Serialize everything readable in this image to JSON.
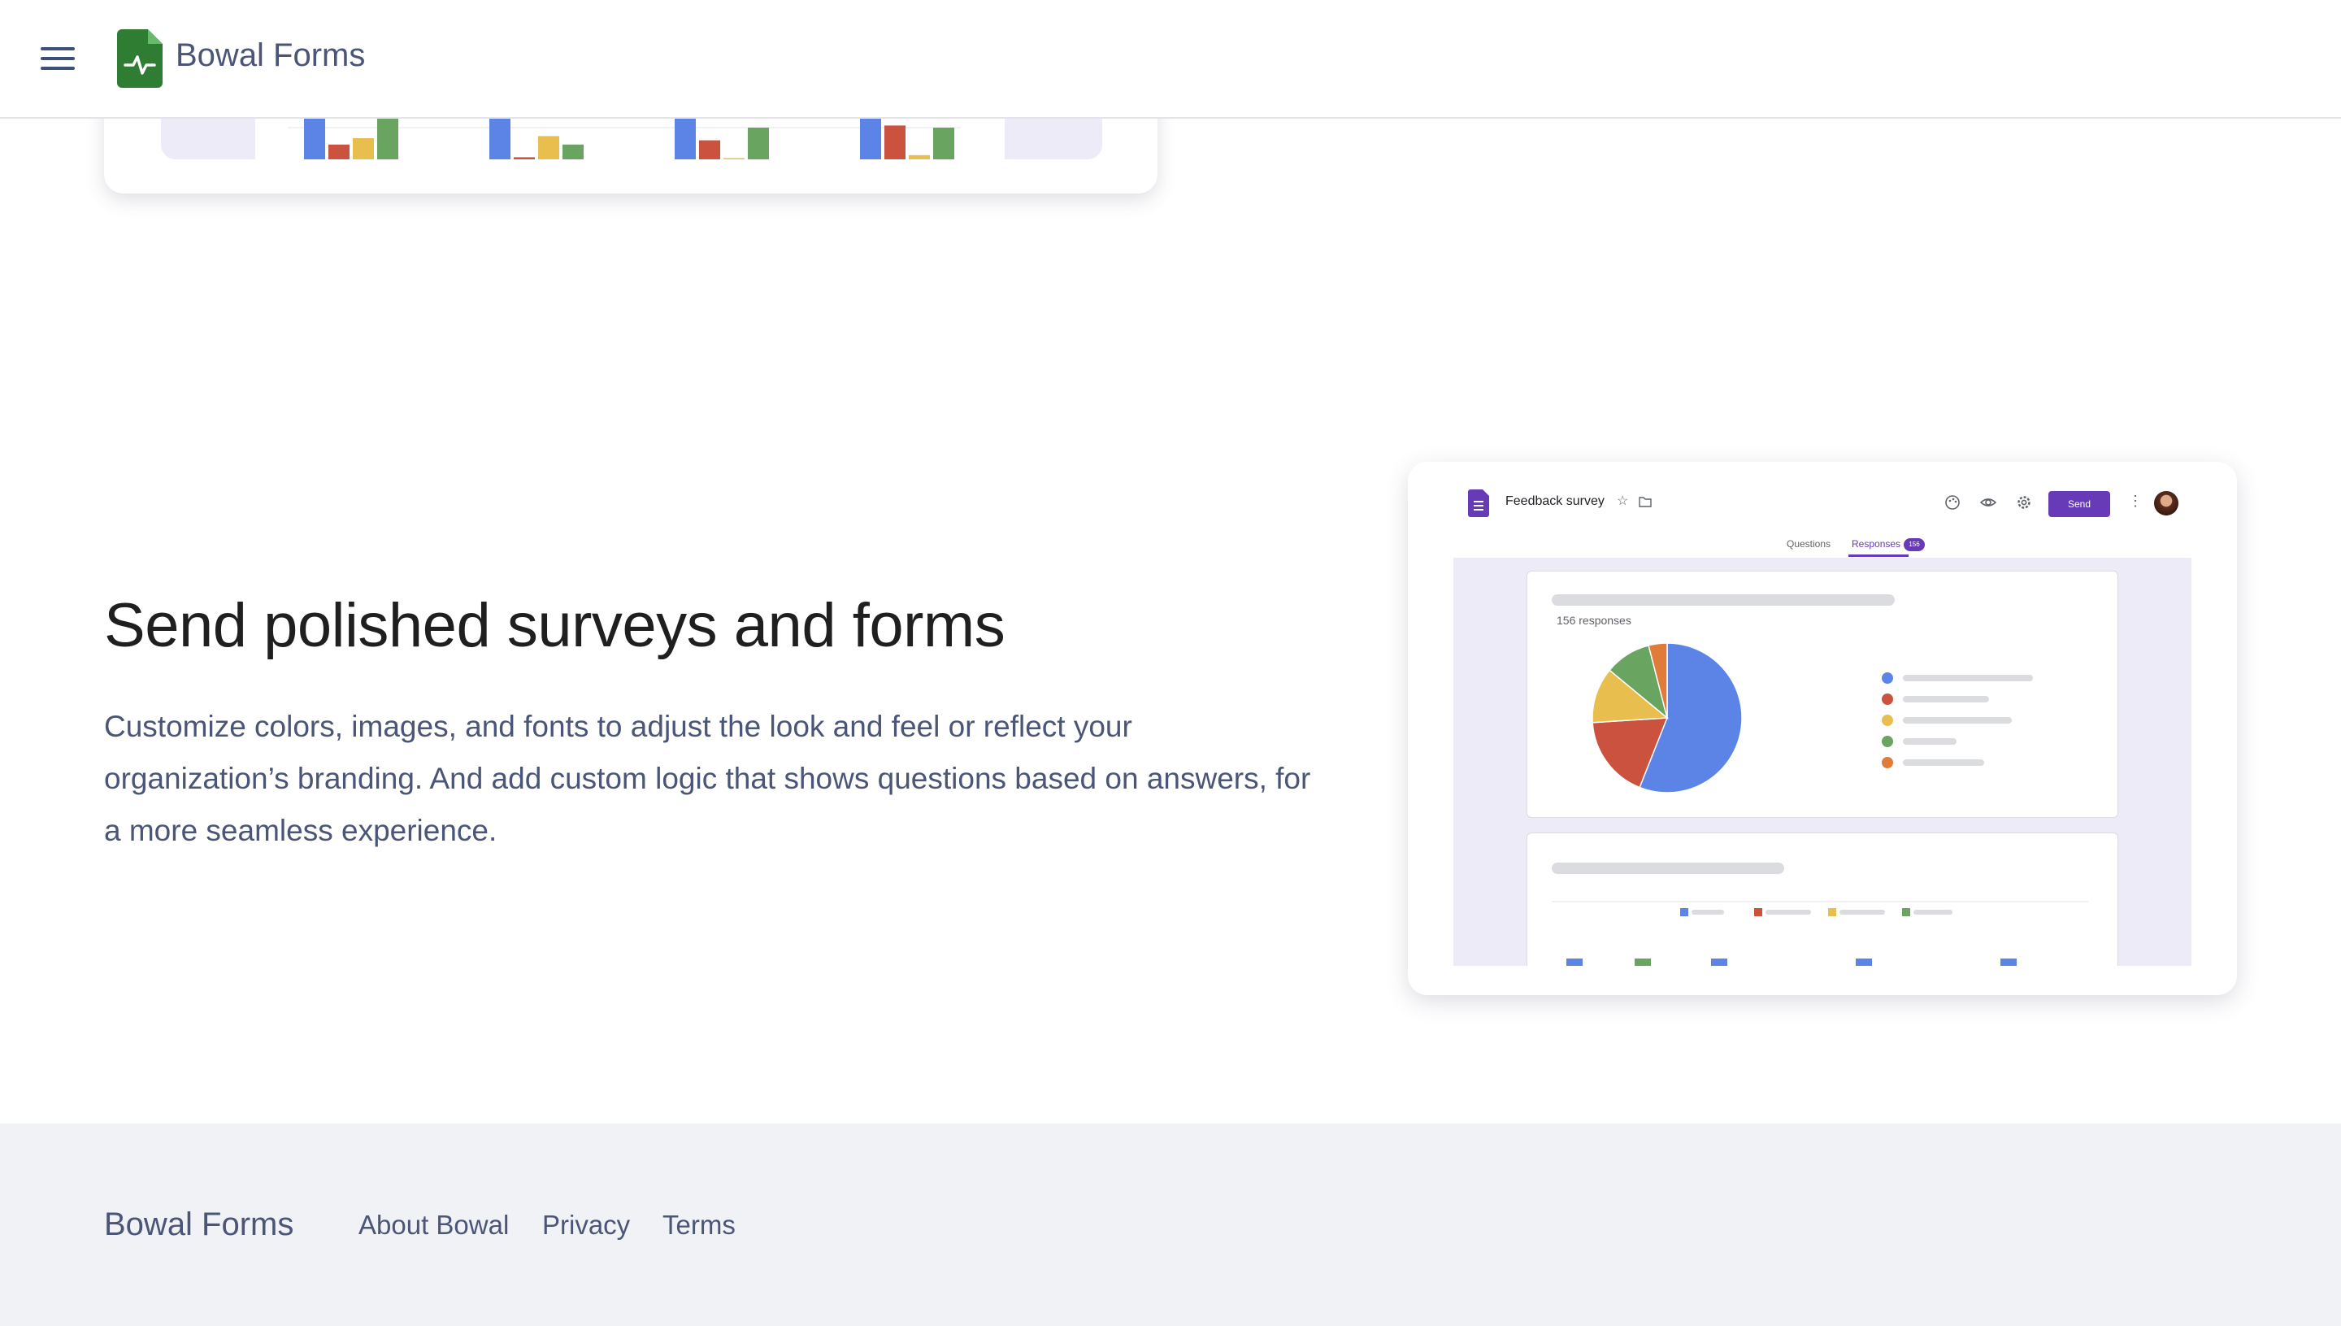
{
  "header": {
    "brand": "Bowal Forms"
  },
  "hero": {
    "title": "Send polished surveys and forms",
    "body": "Customize colors, images, and fonts to adjust the look and feel or reflect your organization’s branding. And add custom logic that shows questions based on answers, for a more seamless experience."
  },
  "mockup": {
    "form_title": "Feedback survey",
    "send_label": "Send",
    "tabs": [
      {
        "label": "Questions",
        "active": false
      },
      {
        "label": "Responses",
        "active": true
      }
    ],
    "responses_badge": "156",
    "responses_count_text": "156 responses",
    "accent_color": "#673ab7",
    "series_colors": [
      "#5b84e6",
      "#cc5240",
      "#e8bf4e",
      "#6aa461",
      "#e07b3a"
    ]
  },
  "chart_data": [
    {
      "type": "pie",
      "values": [
        56,
        18,
        12,
        10,
        4
      ],
      "colors": [
        "#5b84e6",
        "#cc5240",
        "#e8bf4e",
        "#6aa461",
        "#e07b3a"
      ]
    },
    {
      "type": "bar",
      "groups": 4,
      "series_colors": [
        "#5b84e6",
        "#cc5240",
        "#e8bf4e",
        "#6aa461"
      ],
      "values": [
        [
          100,
          35,
          50,
          100
        ],
        [
          100,
          5,
          55,
          35
        ],
        [
          100,
          45,
          0,
          75
        ],
        [
          100,
          80,
          10,
          75
        ]
      ]
    }
  ],
  "footer": {
    "brand": "Bowal Forms",
    "links": [
      "About Bowal",
      "Privacy",
      "Terms"
    ]
  }
}
